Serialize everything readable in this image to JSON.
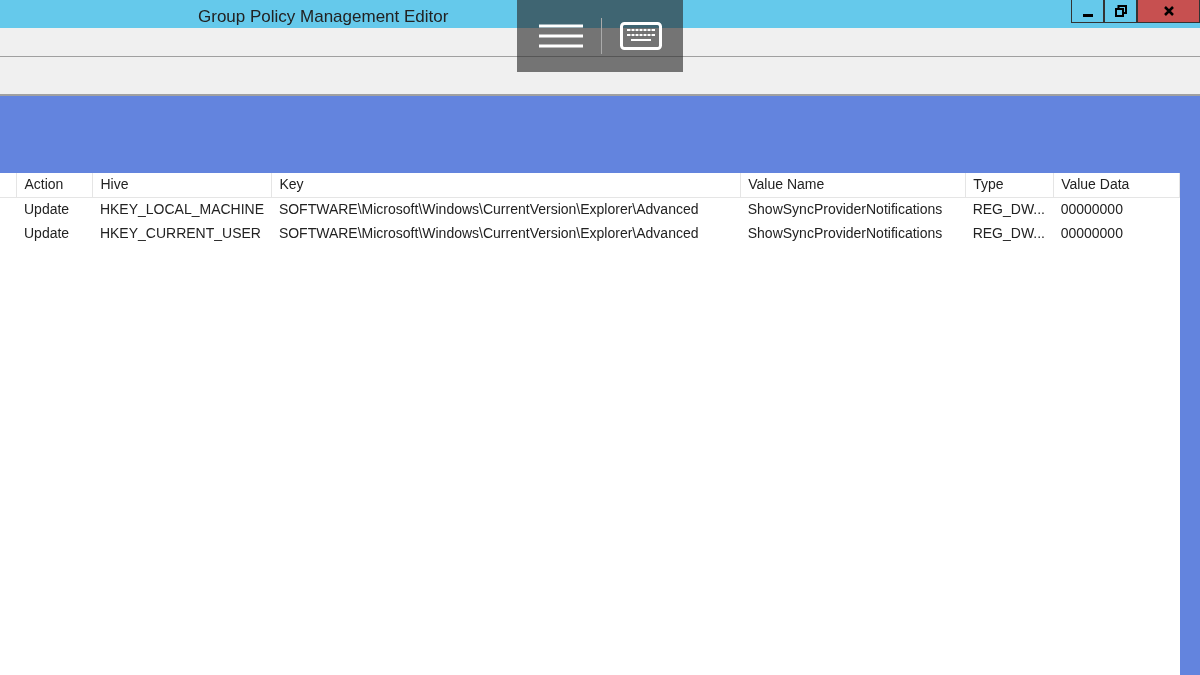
{
  "window": {
    "title": "Group Policy Management Editor"
  },
  "table": {
    "columns": [
      "Action",
      "Hive",
      "Key",
      "Value Name",
      "Type",
      "Value Data"
    ],
    "rows": [
      {
        "cells": [
          "Update",
          "HKEY_LOCAL_MACHINE",
          "SOFTWARE\\Microsoft\\Windows\\CurrentVersion\\Explorer\\Advanced",
          "ShowSyncProviderNotifications",
          "REG_DW...",
          "00000000"
        ]
      },
      {
        "cells": [
          "Update",
          "HKEY_CURRENT_USER",
          "SOFTWARE\\Microsoft\\Windows\\CurrentVersion\\Explorer\\Advanced",
          "ShowSyncProviderNotifications",
          "REG_DW...",
          "00000000"
        ]
      }
    ]
  }
}
